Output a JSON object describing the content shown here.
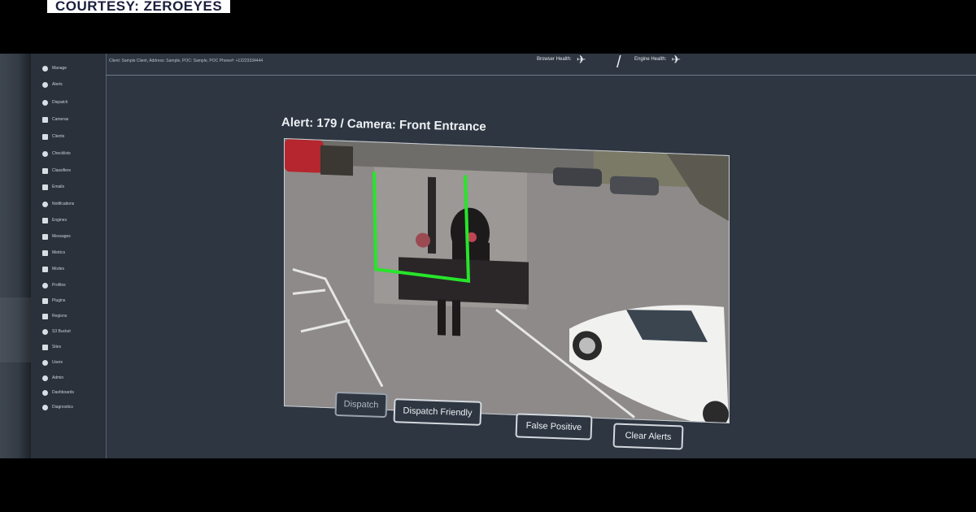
{
  "overlay": {
    "courtesy": "COURTESY: ZEROEYES"
  },
  "topbar": {
    "client_info": "Client: Sample Client, Address: Sample, POC: Sample, POC Phone#: +12223334444",
    "browser_health": "Browser Health:",
    "engine_health": "Engine Health:",
    "separator": "/"
  },
  "sidebar": {
    "items": [
      {
        "label": "Manage",
        "icon": "home-icon"
      },
      {
        "label": "Alerts",
        "icon": "bell-icon"
      },
      {
        "label": "Dispatch",
        "icon": "shield-icon"
      },
      {
        "label": "Cameras",
        "icon": "camera-icon"
      },
      {
        "label": "Clients",
        "icon": "folder-icon"
      },
      {
        "label": "Checklists",
        "icon": "info-icon"
      },
      {
        "label": "Classifiers",
        "icon": "folder-icon"
      },
      {
        "label": "Emails",
        "icon": "share-icon"
      },
      {
        "label": "Notifications",
        "icon": "bell-icon"
      },
      {
        "label": "Engines",
        "icon": "server-icon"
      },
      {
        "label": "Messages",
        "icon": "message-icon"
      },
      {
        "label": "Metrics",
        "icon": "chart-icon"
      },
      {
        "label": "Modes",
        "icon": "folder-icon"
      },
      {
        "label": "Profiles",
        "icon": "eye-icon"
      },
      {
        "label": "Plugins",
        "icon": "plug-icon"
      },
      {
        "label": "Regions",
        "icon": "pencil-icon"
      },
      {
        "label": "S3 Bucket",
        "icon": "cloud-icon"
      },
      {
        "label": "Sites",
        "icon": "file-icon"
      },
      {
        "label": "Users",
        "icon": "user-icon"
      },
      {
        "label": "Admin",
        "icon": "user-icon"
      },
      {
        "label": "Dashboards",
        "icon": "dashboard-icon"
      },
      {
        "label": "Diagnostics",
        "icon": "search-icon"
      }
    ]
  },
  "main": {
    "alert_title": "Alert: 179 / Camera: Front Entrance",
    "buttons": {
      "dispatch": "Dispatch",
      "dispatch_friendly": "Dispatch Friendly",
      "false_positive": "False Positive",
      "clear_alerts": "Clear Alerts"
    }
  },
  "colors": {
    "detection_box": "#27e52a",
    "screen_bg": "#2e3641",
    "button_border": "#d4d9df"
  }
}
